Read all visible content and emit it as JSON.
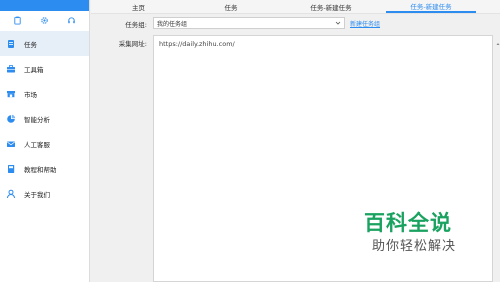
{
  "sidebar": {
    "top_icons": [
      {
        "icon": "clipboard-icon"
      },
      {
        "icon": "gear-icon"
      },
      {
        "icon": "headset-icon"
      }
    ],
    "items": [
      {
        "label": "任务",
        "icon": "task-list-icon",
        "active": true
      },
      {
        "label": "工具箱",
        "icon": "toolbox-icon",
        "active": false
      },
      {
        "label": "市场",
        "icon": "store-icon",
        "active": false
      },
      {
        "label": "智能分析",
        "icon": "pie-chart-icon",
        "active": false
      },
      {
        "label": "人工客服",
        "icon": "mail-icon",
        "active": false
      },
      {
        "label": "教程和帮助",
        "icon": "book-icon",
        "active": false
      },
      {
        "label": "关于我们",
        "icon": "user-icon",
        "active": false
      }
    ]
  },
  "tabs": [
    {
      "label": "主页"
    },
    {
      "label": "任务"
    },
    {
      "label": "任务-新建任务"
    },
    {
      "label": "任务-新建任务",
      "active": true
    }
  ],
  "form": {
    "group_label": "任务组:",
    "group_value": "我的任务组",
    "new_group_link": "新建任务组",
    "url_label": "采集网址:",
    "url_value": "https://daily.zhihu.com/"
  },
  "watermark": {
    "title": "百科全说",
    "subtitle": "助你轻松解决"
  },
  "colors": {
    "accent": "#2d8cf0",
    "watermark_green": "#1aa260"
  }
}
